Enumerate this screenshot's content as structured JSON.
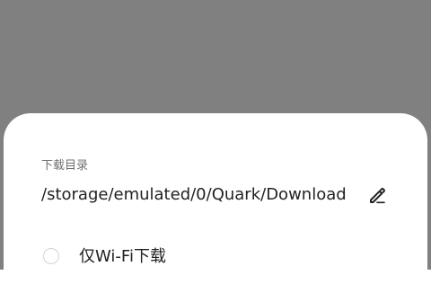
{
  "download_sheet": {
    "section_label": "下载目录",
    "path": "/storage/emulated/0/Quark/Download",
    "edit_icon": "pencil-edit-icon",
    "wifi_only_option": {
      "label": "仅Wi-Fi下载",
      "checked": false
    }
  },
  "colors": {
    "backdrop": "#808080",
    "sheet": "#ffffff",
    "label_text": "#6f6f6f",
    "primary_text": "#222222",
    "radio_border": "#d4d4d4"
  }
}
